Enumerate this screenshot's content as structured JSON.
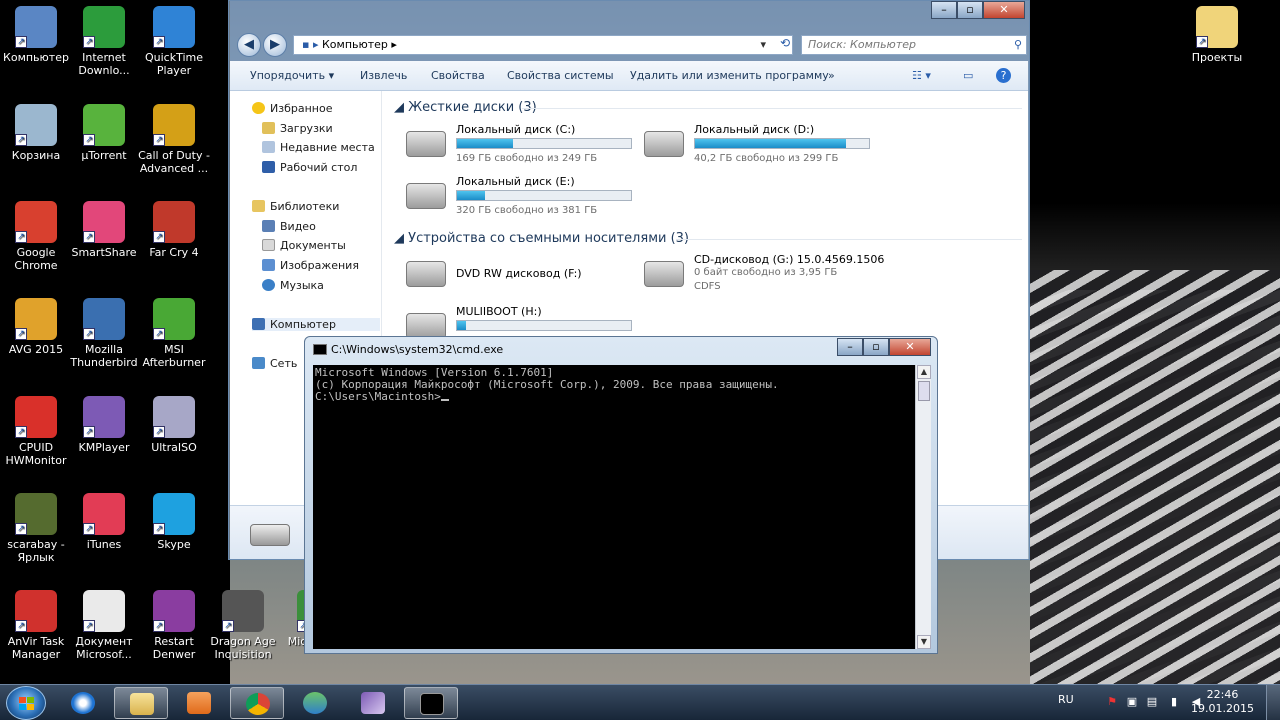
{
  "desktop": {
    "icons": [
      {
        "label": "Компьютер",
        "icon": "computer-icon",
        "color": "#5a86c4"
      },
      {
        "label": "Internet Downlo...",
        "icon": "idm-icon",
        "color": "#2c9c3c"
      },
      {
        "label": "QuickTime Player",
        "icon": "quicktime-icon",
        "color": "#2f83d6"
      },
      {
        "label": "Корзина",
        "icon": "recycle-bin-icon",
        "color": "#9bb7cf"
      },
      {
        "label": "µTorrent",
        "icon": "utorrent-icon",
        "color": "#58b33d"
      },
      {
        "label": "Call of Duty - Advanced ...",
        "icon": "call-of-duty-icon",
        "color": "#d4a017"
      },
      {
        "label": "Google Chrome",
        "icon": "chrome-icon",
        "color": "#d8402f"
      },
      {
        "label": "SmartShare",
        "icon": "smartshare-icon",
        "color": "#e2477a"
      },
      {
        "label": "Far Cry 4",
        "icon": "far-cry-icon",
        "color": "#c0392b"
      },
      {
        "label": "AVG 2015",
        "icon": "avg-icon",
        "color": "#e0a22b"
      },
      {
        "label": "Mozilla Thunderbird",
        "icon": "thunderbird-icon",
        "color": "#3a6fb0"
      },
      {
        "label": "MSI Afterburner",
        "icon": "msi-afterburner-icon",
        "color": "#49a835"
      },
      {
        "label": "CPUID HWMonitor",
        "icon": "hwmonitor-icon",
        "color": "#d9302a"
      },
      {
        "label": "KMPlayer",
        "icon": "kmplayer-icon",
        "color": "#7d5ab5"
      },
      {
        "label": "UltraISO",
        "icon": "ultraiso-icon",
        "color": "#a7a7c7"
      },
      {
        "label": "iTunes",
        "icon": "itunes-icon",
        "color": "#e23c55"
      },
      {
        "label": "Skype",
        "icon": "skype-icon",
        "color": "#1ea1e0"
      },
      {
        "label": "scarabay - Ярлык",
        "icon": "scarabay-icon",
        "color": "#556b2f"
      },
      {
        "label": "AnVir Task Manager",
        "icon": "anvir-icon",
        "color": "#d0312d"
      },
      {
        "label": "Документ Microsof...",
        "icon": "word-document-icon",
        "color": "#eaeaea"
      },
      {
        "label": "Restart Denwer",
        "icon": "denwer-icon",
        "color": "#8a3da0"
      },
      {
        "label": "Dragon Age Inquisition",
        "icon": "dragon-age-icon",
        "color": "#555555"
      },
      {
        "label": "Microsoft...",
        "icon": "microsoft-icon",
        "color": "#3b8f3b"
      },
      {
        "label": "Проекты",
        "icon": "folder-icon",
        "color": "#f0d47a"
      }
    ]
  },
  "explorer": {
    "address": "Компьютер",
    "search_placeholder": "Поиск: Компьютер",
    "toolbar": {
      "organize": "Упорядочить",
      "eject": "Извлечь",
      "properties": "Свойства",
      "system_properties": "Свойства системы",
      "uninstall": "Удалить или изменить программу",
      "more": "»"
    },
    "nav": {
      "favorites": "Избранное",
      "downloads": "Загрузки",
      "recent": "Недавние места",
      "desktop": "Рабочий стол",
      "libraries": "Библиотеки",
      "video": "Видео",
      "documents": "Документы",
      "images": "Изображения",
      "music": "Музыка",
      "computer": "Компьютер",
      "network": "Сеть"
    },
    "groups": {
      "hard_disks": "Жесткие диски (3)",
      "removable": "Устройства со съемными носителями (3)"
    },
    "drives": [
      {
        "name": "Локальный диск (C:)",
        "free": "169 ГБ свободно из 249 ГБ",
        "used_fraction": 0.32
      },
      {
        "name": "Локальный диск (D:)",
        "free": "40,2 ГБ свободно из 299 ГБ",
        "used_fraction": 0.87
      },
      {
        "name": "Локальный диск (E:)",
        "free": "320 ГБ свободно из 381 ГБ",
        "used_fraction": 0.16
      }
    ],
    "removable": [
      {
        "name": "DVD RW дисковод (F:)"
      },
      {
        "name": "CD-дисковод (G:) 15.0.4569.1506",
        "free": "0 байт свободно из 3,95 ГБ",
        "fs": "CDFS"
      },
      {
        "name": "MULIIBOOT (H:)",
        "used_fraction": 0.05
      }
    ]
  },
  "cmd": {
    "title": "C:\\Windows\\system32\\cmd.exe",
    "lines": [
      "Microsoft Windows [Version 6.1.7601]",
      "(c) Корпорация Майкрософт (Microsoft Corp.), 2009. Все права защищены.",
      "",
      "C:\\Users\\Macintosh>"
    ]
  },
  "taskbar": {
    "language": "RU",
    "time": "22:46",
    "date": "19.01.2015"
  }
}
